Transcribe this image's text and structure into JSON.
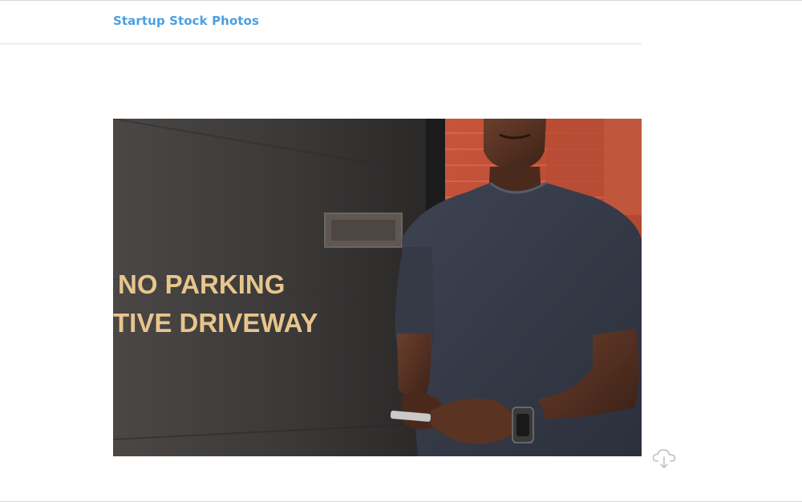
{
  "header": {
    "brand": "Startup Stock Photos"
  },
  "photo": {
    "sign_line_1": "NO PARKING",
    "sign_line_2": "TIVE DRIVEWAY"
  },
  "actions": {
    "download_icon": "cloud-download-icon"
  },
  "colors": {
    "brand": "#4a9fe3",
    "divider": "#f1f1f1",
    "icon": "#bcbcbc"
  }
}
